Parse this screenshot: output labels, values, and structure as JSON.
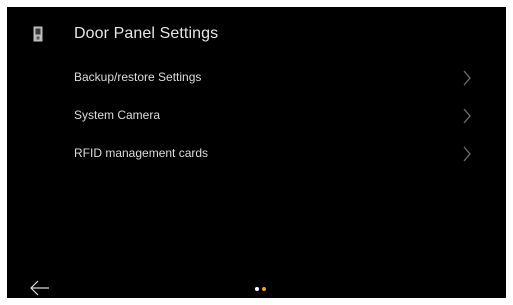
{
  "header": {
    "title": "Door Panel Settings",
    "icon": "door-panel-icon"
  },
  "menu": {
    "items": [
      {
        "label": "Backup/restore Settings",
        "icon": "chevron-right-icon"
      },
      {
        "label": "System Camera",
        "icon": "chevron-right-icon"
      },
      {
        "label": "RFID management cards",
        "icon": "chevron-right-icon"
      }
    ]
  },
  "footer": {
    "back_icon": "back-arrow-icon",
    "page_indicator": {
      "count": 2,
      "active_index": 1
    }
  },
  "colors": {
    "background": "#000000",
    "text": "#dcdcdc",
    "chevron": "#6e6e6e",
    "dot_inactive": "#ffffff",
    "dot_active": "#f0a800"
  }
}
